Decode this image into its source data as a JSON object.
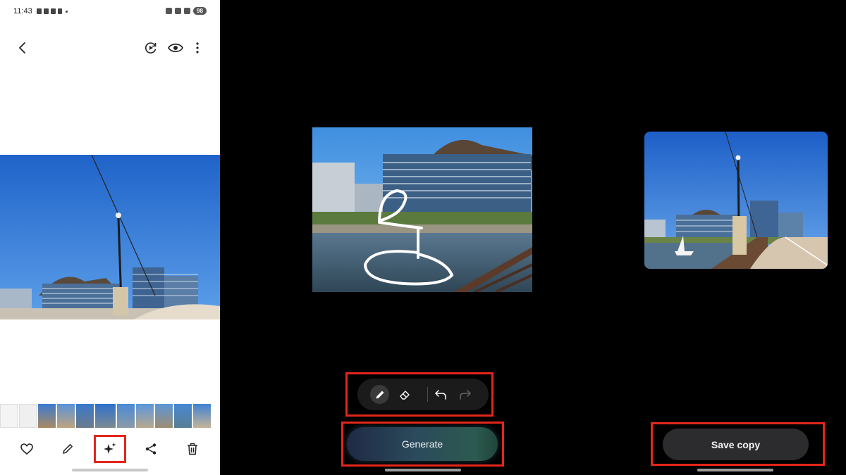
{
  "status_bar": {
    "time": "11:43",
    "battery": "98"
  },
  "viewer": {
    "back_icon": "arrow-left-icon",
    "top_actions": [
      "remaster-icon",
      "eye-icon",
      "more-vertical-icon"
    ],
    "bottom_actions": [
      "heart-icon",
      "pencil-icon",
      "sparkle-ai-icon",
      "share-icon",
      "trash-icon"
    ],
    "filmstrip_count": 11,
    "selected_thumb_index": 5
  },
  "edit_panel": {
    "tools": [
      "pencil-icon",
      "eraser-icon",
      "undo-icon",
      "redo-icon"
    ],
    "active_tool": "pencil-icon",
    "generate_label": "Generate"
  },
  "result_panel": {
    "save_label": "Save copy"
  },
  "colors": {
    "highlight": "#e4261a",
    "sky": "#2f7fd8",
    "panel_bg": "#000000"
  }
}
